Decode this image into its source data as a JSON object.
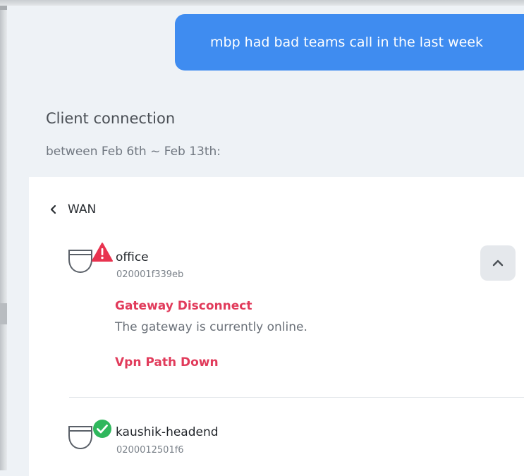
{
  "chat": {
    "user_message": "mbp had bad teams call in the last week"
  },
  "result": {
    "title": "Client connection",
    "subtitle": "between Feb 6th ~ Feb 13th:"
  },
  "card": {
    "back_label": "WAN",
    "gateways": [
      {
        "name": "office",
        "id": "020001f339eb",
        "status": "warning",
        "alerts": [
          {
            "title": "Gateway Disconnect",
            "description": "The gateway is currently online."
          },
          {
            "title": "Vpn Path Down"
          }
        ]
      },
      {
        "name": "kaushik-headend",
        "id": "0200012501f6",
        "status": "ok"
      }
    ]
  },
  "colors": {
    "accent_blue": "#3f8cf0",
    "alert_red": "#e13b5b",
    "ok_green": "#2fb75c"
  }
}
